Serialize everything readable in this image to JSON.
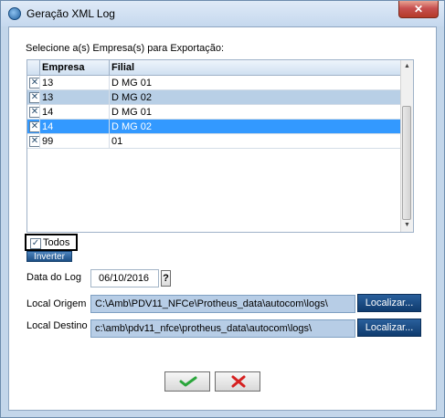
{
  "window": {
    "title": "Geração XML Log",
    "close_glyph": "✕"
  },
  "icons": {
    "app": "app-icon",
    "close": "close-icon",
    "ok": "check-icon",
    "cancel": "x-icon",
    "help": "help-icon"
  },
  "companies": {
    "caption": "Selecione a(s) Empresa(s) para Exportação:",
    "columns": [
      "Empresa",
      "Filial"
    ],
    "rows": [
      {
        "checked": true,
        "empresa": "13",
        "filial": "D MG 01",
        "style": "normal"
      },
      {
        "checked": true,
        "empresa": "13",
        "filial": "D MG 02",
        "style": "alt"
      },
      {
        "checked": true,
        "empresa": "14",
        "filial": "D MG 01",
        "style": "normal"
      },
      {
        "checked": true,
        "empresa": "14",
        "filial": "D MG 02",
        "style": "selected"
      },
      {
        "checked": true,
        "empresa": "99",
        "filial": "01",
        "style": "normal"
      }
    ]
  },
  "todos": {
    "label": "Todos",
    "checked": true
  },
  "inverter": {
    "label": "Inverter"
  },
  "data_log": {
    "label": "Data do Log",
    "value": "06/10/2016",
    "help": "?"
  },
  "local_origem": {
    "label": "Local Origem",
    "value": "C:\\Amb\\PDV11_NFCe\\Protheus_data\\autocom\\logs\\",
    "button": "Localizar..."
  },
  "local_destino": {
    "label": "Local Destino",
    "value": "c:\\amb\\pdv11_nfce\\protheus_data\\autocom\\logs\\",
    "button": "Localizar..."
  },
  "colors": {
    "selected_row": "#3399ff",
    "alt_row": "#b8cfe6",
    "ok_check": "#2aa63b",
    "cancel_x": "#d62020"
  }
}
